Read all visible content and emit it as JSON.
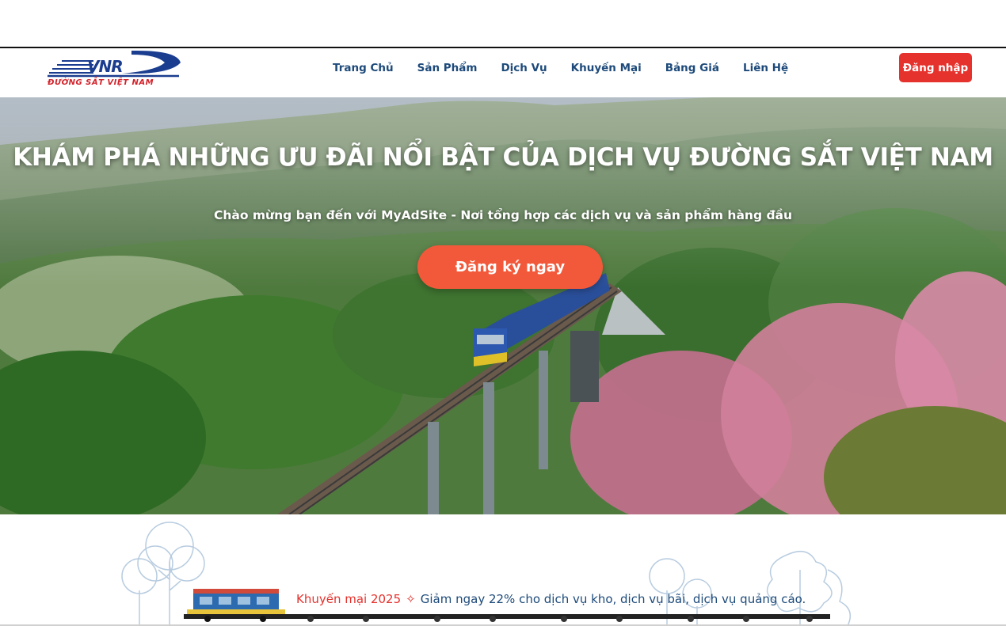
{
  "brand": {
    "logo_text": "VNR",
    "logo_subtitle": "ĐƯỜNG SẮT VIỆT NAM"
  },
  "nav": {
    "items": [
      {
        "label": "Trang Chủ"
      },
      {
        "label": "Sản Phẩm"
      },
      {
        "label": "Dịch Vụ"
      },
      {
        "label": "Khuyến Mại"
      },
      {
        "label": "Bảng Giá"
      },
      {
        "label": "Liên Hệ"
      }
    ],
    "login_label": "Đăng nhập"
  },
  "hero": {
    "title": "KHÁM PHÁ NHỮNG ƯU ĐÃI NỔI BẬT CỦA DỊCH VỤ ĐƯỜNG SẮT VIỆT NAM",
    "subtitle": "Chào mừng bạn đến với MyAdSite - Nơi tổng hợp các dịch vụ và sản phẩm hàng đầu",
    "cta_label": "Đăng ký ngay"
  },
  "promo": {
    "label": "Khuyến mại 2025",
    "icon": "sparkle-icon",
    "message": "Giảm ngay 22% cho dịch vụ kho, dịch vụ bãi, dịch vụ quảng cáo."
  },
  "colors": {
    "brand_red": "#e5322d",
    "cta_orange": "#f2593a",
    "nav_blue": "#1d4a7a",
    "logo_blue": "#1a3d8f"
  }
}
